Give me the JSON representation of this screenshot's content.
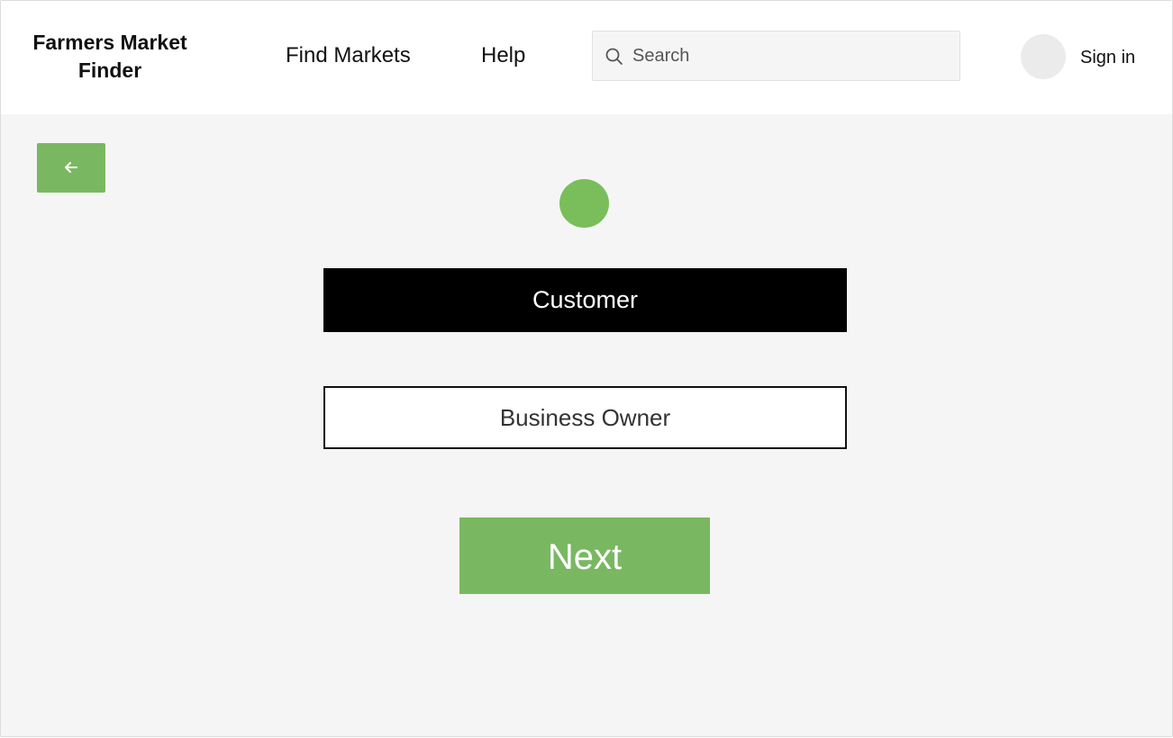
{
  "header": {
    "brand": "Farmers Market Finder",
    "nav": {
      "find_markets": "Find Markets",
      "help": "Help"
    },
    "search": {
      "placeholder": "Search",
      "icon": "search-icon"
    },
    "user": {
      "avatar_icon": "avatar",
      "sign_in": "Sign in"
    }
  },
  "main": {
    "back_icon": "arrow-left-icon",
    "step_indicator": "circle",
    "options": [
      {
        "label": "Customer",
        "selected": true
      },
      {
        "label": "Business Owner",
        "selected": false
      }
    ],
    "next_label": "Next"
  },
  "colors": {
    "accent_green": "#79b861",
    "step_dot_green": "#79be5b",
    "selected_bg": "#000000",
    "page_bg": "#f5f5f5"
  }
}
